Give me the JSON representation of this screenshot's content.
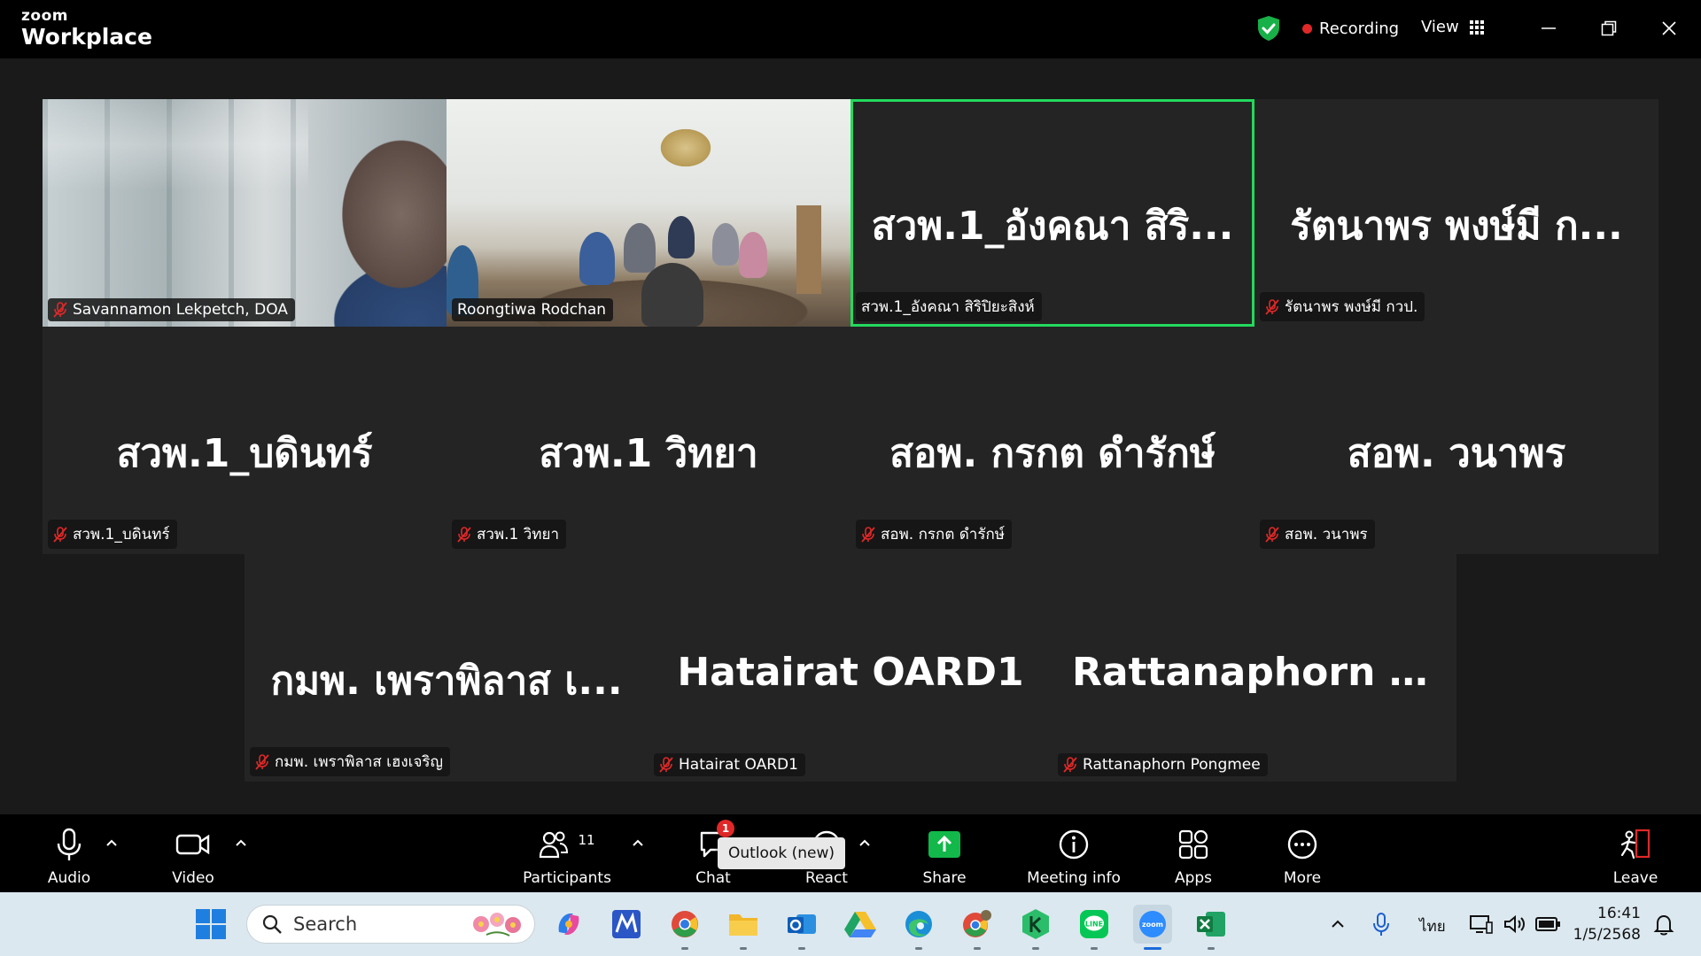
{
  "titlebar": {
    "brand_small": "zoom",
    "brand_big": "Workplace",
    "recording_label": "Recording",
    "view_label": "View"
  },
  "gallery": {
    "tiles": [
      {
        "display_name": "",
        "label": "Savannamon Lekpetch, DOA",
        "muted": true,
        "has_video": true,
        "active": false
      },
      {
        "display_name": "",
        "label": "Roongtiwa Rodchan",
        "muted": false,
        "has_video": true,
        "active": false
      },
      {
        "display_name": "สวพ.1_อังคณา สิริ...",
        "label": "สวพ.1_อังคณา สิริปิยะสิงห์",
        "muted": false,
        "has_video": false,
        "active": true
      },
      {
        "display_name": "รัตนาพร พงษ์มี ก...",
        "label": "รัตนาพร พงษ์มี กวป.",
        "muted": true,
        "has_video": false,
        "active": false
      },
      {
        "display_name": "สวพ.1_บดินทร์",
        "label": "สวพ.1_บดินทร์",
        "muted": true,
        "has_video": false,
        "active": false
      },
      {
        "display_name": "สวพ.1 วิทยา",
        "label": "สวพ.1 วิทยา",
        "muted": true,
        "has_video": false,
        "active": false
      },
      {
        "display_name": "สอพ. กรกต ดำรักษ์",
        "label": "สอพ. กรกต ดำรักษ์",
        "muted": true,
        "has_video": false,
        "active": false
      },
      {
        "display_name": "สอพ. วนาพร",
        "label": "สอพ. วนาพร",
        "muted": true,
        "has_video": false,
        "active": false
      },
      {
        "display_name": "กมพ. เพราพิลาส เ...",
        "label": "กมพ. เพราพิลาส เฮงเจริญ",
        "muted": true,
        "has_video": false,
        "active": false
      },
      {
        "display_name": "Hatairat OARD1",
        "label": "Hatairat OARD1",
        "muted": true,
        "has_video": false,
        "active": false
      },
      {
        "display_name": "Rattanaphorn P...",
        "label": "Rattanaphorn Pongmee",
        "muted": true,
        "has_video": false,
        "active": false
      }
    ]
  },
  "toolbar": {
    "audio_label": "Audio",
    "video_label": "Video",
    "participants_label": "Participants",
    "participants_count": "11",
    "chat_label": "Chat",
    "chat_badge": "1",
    "react_label": "React",
    "share_label": "Share",
    "meeting_info_label": "Meeting info",
    "apps_label": "Apps",
    "more_label": "More",
    "leave_label": "Leave",
    "tooltip": "Outlook (new)"
  },
  "taskbar": {
    "search_label": "Search",
    "language": "ไทย",
    "time": "16:41",
    "date": "1/5/2568"
  },
  "colors": {
    "active_speaker": "#23d95e",
    "share_green": "#12b84a",
    "recording_red": "#e02828"
  }
}
